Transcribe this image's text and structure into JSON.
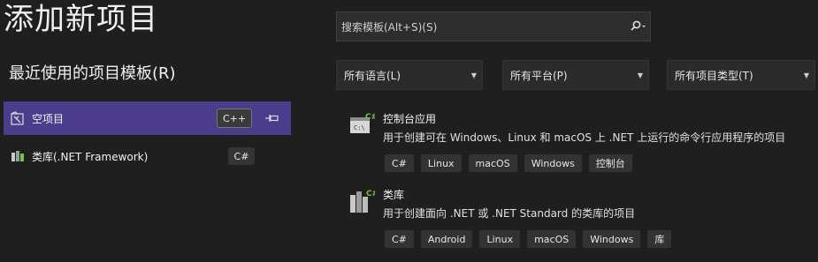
{
  "header": {
    "title": "添加新项目"
  },
  "recent": {
    "title": "最近使用的项目模板(R)",
    "items": [
      {
        "name": "空项目",
        "lang": "C++",
        "pinned": true
      },
      {
        "name": "类库(.NET Framework)",
        "lang": "C#",
        "pinned": false
      }
    ]
  },
  "search": {
    "placeholder": "搜索模板(Alt+S)(S)"
  },
  "filters": {
    "language": "所有语言(L)",
    "platform": "所有平台(P)",
    "project_type": "所有项目类型(T)"
  },
  "results": [
    {
      "name": "控制台应用",
      "description": "用于创建可在 Windows、Linux 和 macOS 上 .NET 上运行的命令行应用程序的项目",
      "tags": [
        "C#",
        "Linux",
        "macOS",
        "Windows",
        "控制台"
      ]
    },
    {
      "name": "类库",
      "description": "用于创建面向 .NET 或 .NET Standard 的类库的项目",
      "tags": [
        "C#",
        "Android",
        "Linux",
        "macOS",
        "Windows",
        "库"
      ]
    }
  ],
  "colors": {
    "accent": "#4b3c8c",
    "background": "#1f1f1f",
    "csharp": "#6fc349"
  }
}
